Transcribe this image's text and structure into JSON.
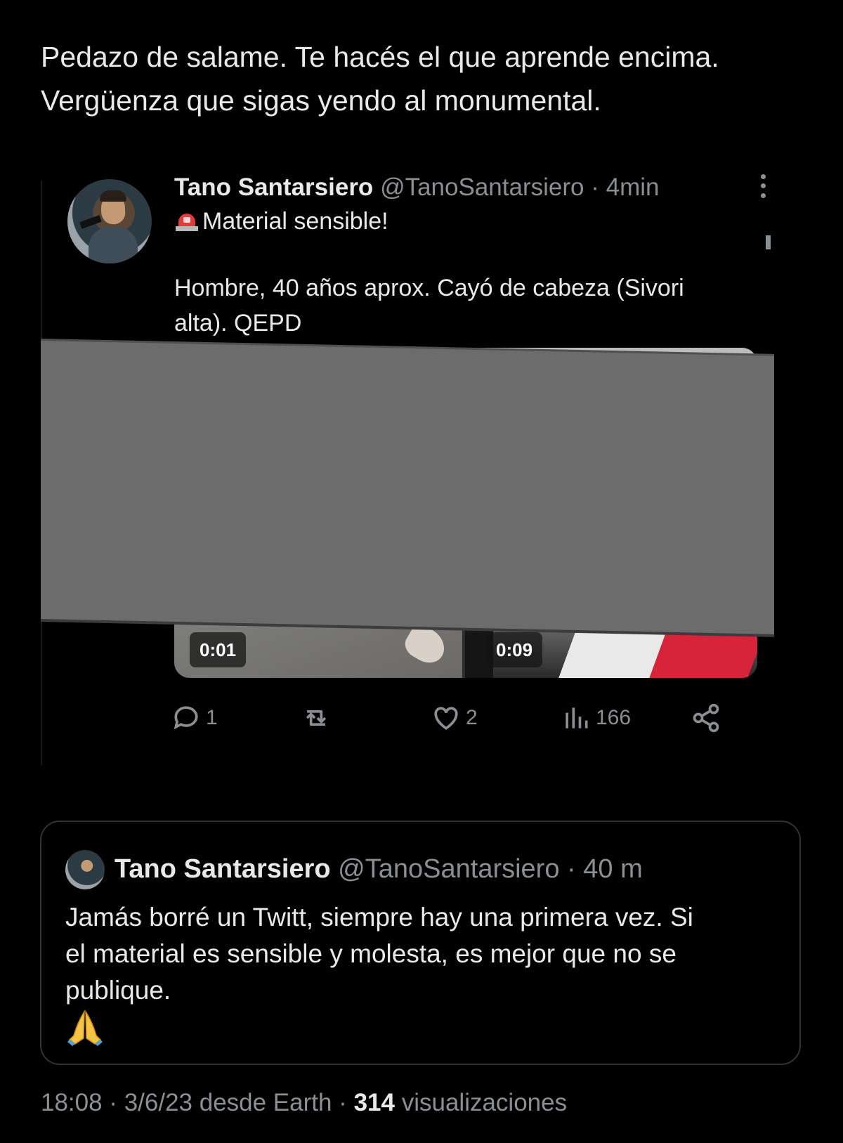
{
  "main_tweet": {
    "lines": [
      "Pedazo de salame. Te hacés el que aprende encima.",
      "Vergüenza  que sigas yendo al monumental."
    ]
  },
  "embedded_tweet": {
    "name": "Tano Santarsiero",
    "handle": "@TanoSantarsiero",
    "time": "· 4min",
    "alert": "Material sensible!",
    "body_lines": [
      "Hombre, 40 años aprox. Cayó de cabeza (Sivori",
      "alta). QEPD"
    ],
    "videos": [
      {
        "duration": "0:01"
      },
      {
        "duration": "0:09"
      }
    ],
    "actions": {
      "replies": "1",
      "likes": "2",
      "views": "166"
    }
  },
  "quoted_tweet": {
    "name": "Tano Santarsiero",
    "handle": "@TanoSantarsiero",
    "time": "· 40 m",
    "body_lines": [
      "Jamás borré un Twitt, siempre hay una primera vez. Si",
      "el material es sensible y molesta, es mejor que no se",
      "publique."
    ]
  },
  "footer": {
    "meta": "18:08 · 3/6/23 desde Earth · ",
    "views_count": "314",
    "views_label": " visualizaciones"
  },
  "colors": {
    "background": "#000000",
    "text": "#e7e9ea",
    "muted": "#8b8f94",
    "censor": "#6c6c6c",
    "card_border": "#2f3336"
  }
}
